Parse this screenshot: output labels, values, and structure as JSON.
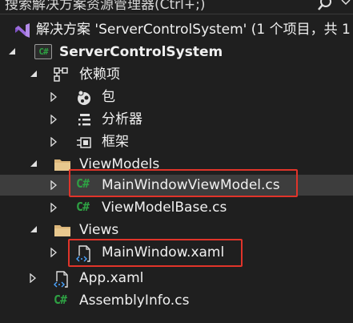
{
  "search": {
    "placeholder": "搜索解决方案资源管理器(Ctrl+;)"
  },
  "tree": {
    "solution": "解决方案 'ServerControlSystem' (1 个项目，共 1",
    "project": "ServerControlSystem",
    "dependencies": "依赖项",
    "packages": "包",
    "analyzers": "分析器",
    "frameworks": "框架",
    "viewmodels_folder": "ViewModels",
    "mainwindowviewmodel": "MainWindowViewModel.cs",
    "viewmodelbase": "ViewModelBase.cs",
    "views_folder": "Views",
    "mainwindow_xaml": "MainWindow.xaml",
    "app_xaml": "App.xaml",
    "assemblyinfo": "AssemblyInfo.cs",
    "cs_badge": "C#",
    "cs_box_badge": "C#"
  },
  "colors": {
    "background": "#1f1f1f",
    "selected_row": "#3d3d3d",
    "highlight_border": "#e0342a",
    "csharp_green": "#2ea043",
    "folder_yellow": "#dcb67a",
    "solution_purple": "#9b6bdc"
  },
  "icons": [
    "search-icon",
    "solution-icon",
    "csharp-project-icon",
    "dependencies-icon",
    "package-icon",
    "analyzer-icon",
    "framework-icon",
    "folder-icon",
    "xaml-file-icon",
    "csharp-file-icon"
  ]
}
